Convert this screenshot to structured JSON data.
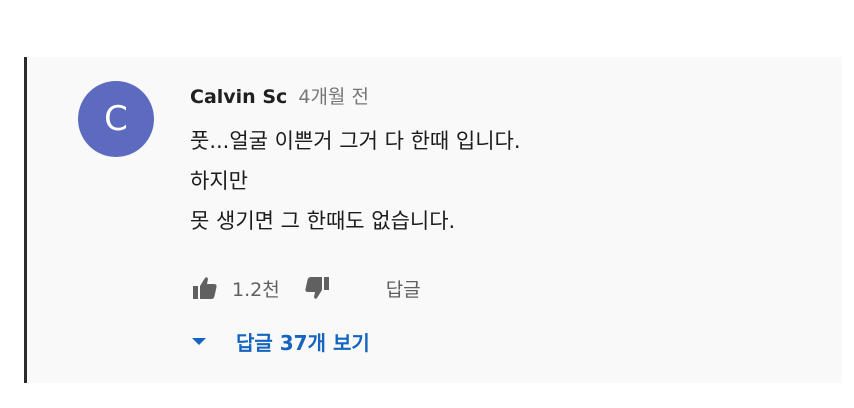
{
  "comment": {
    "avatar_letter": "C",
    "avatar_color": "#5c6bc0",
    "author": "Calvin Sc",
    "time": "4개월 전",
    "text_lines": [
      "풋...얼굴 이쁜거 그거 다 한때 입니다.",
      "하지만",
      "못 생기면 그 한때도 없습니다."
    ]
  },
  "actions": {
    "like_icon": "thumbs-up-icon",
    "like_count": "1.2천",
    "dislike_icon": "thumbs-down-icon",
    "reply_label": "답글"
  },
  "replies": {
    "toggle_icon": "caret-down-icon",
    "label": "답글 37개 보기",
    "accent_color": "#1565c0"
  }
}
